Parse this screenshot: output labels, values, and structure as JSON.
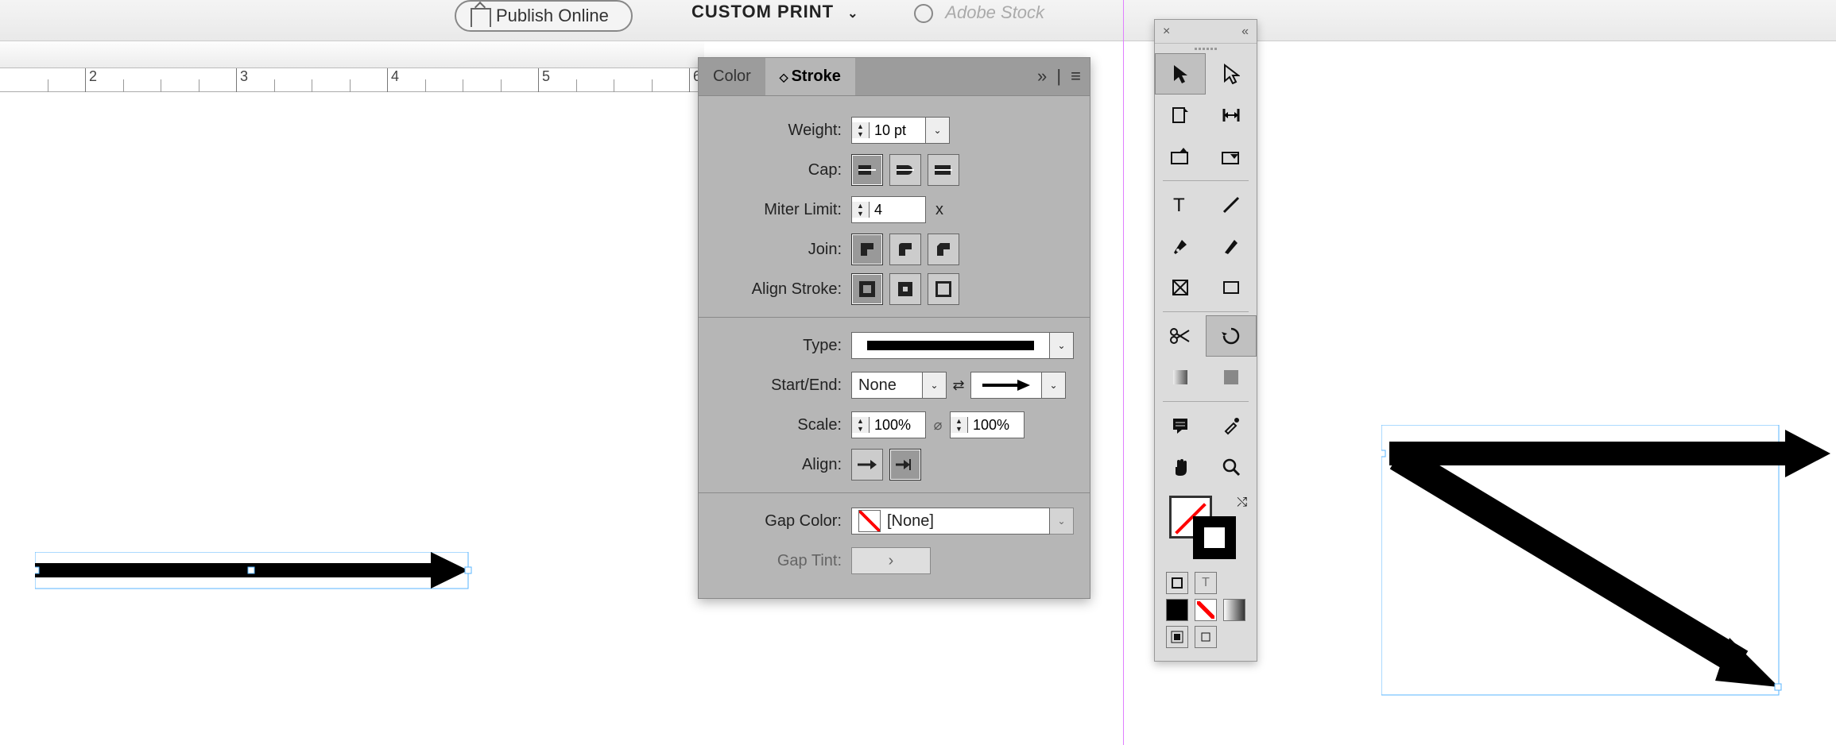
{
  "topbar": {
    "publish_label": "Publish Online",
    "preset_label": "CUSTOM PRINT",
    "stock_placeholder": "Adobe Stock"
  },
  "ruler": {
    "marks": [
      "2",
      "3",
      "4",
      "5",
      "6"
    ]
  },
  "panel": {
    "tabs": {
      "color": "Color",
      "stroke": "Stroke"
    },
    "weight_label": "Weight:",
    "weight_value": "10 pt",
    "cap_label": "Cap:",
    "miter_label": "Miter Limit:",
    "miter_value": "4",
    "miter_suffix": "x",
    "join_label": "Join:",
    "align_label": "Align Stroke:",
    "type_label": "Type:",
    "startend_label": "Start/End:",
    "start_value": "None",
    "scale_label": "Scale:",
    "scale_start": "100%",
    "scale_end": "100%",
    "align_arrow_label": "Align:",
    "gapcolor_label": "Gap Color:",
    "gapcolor_value": "[None]",
    "gaptint_label": "Gap Tint:"
  },
  "tools": {
    "close": "×",
    "collapse": "«"
  }
}
